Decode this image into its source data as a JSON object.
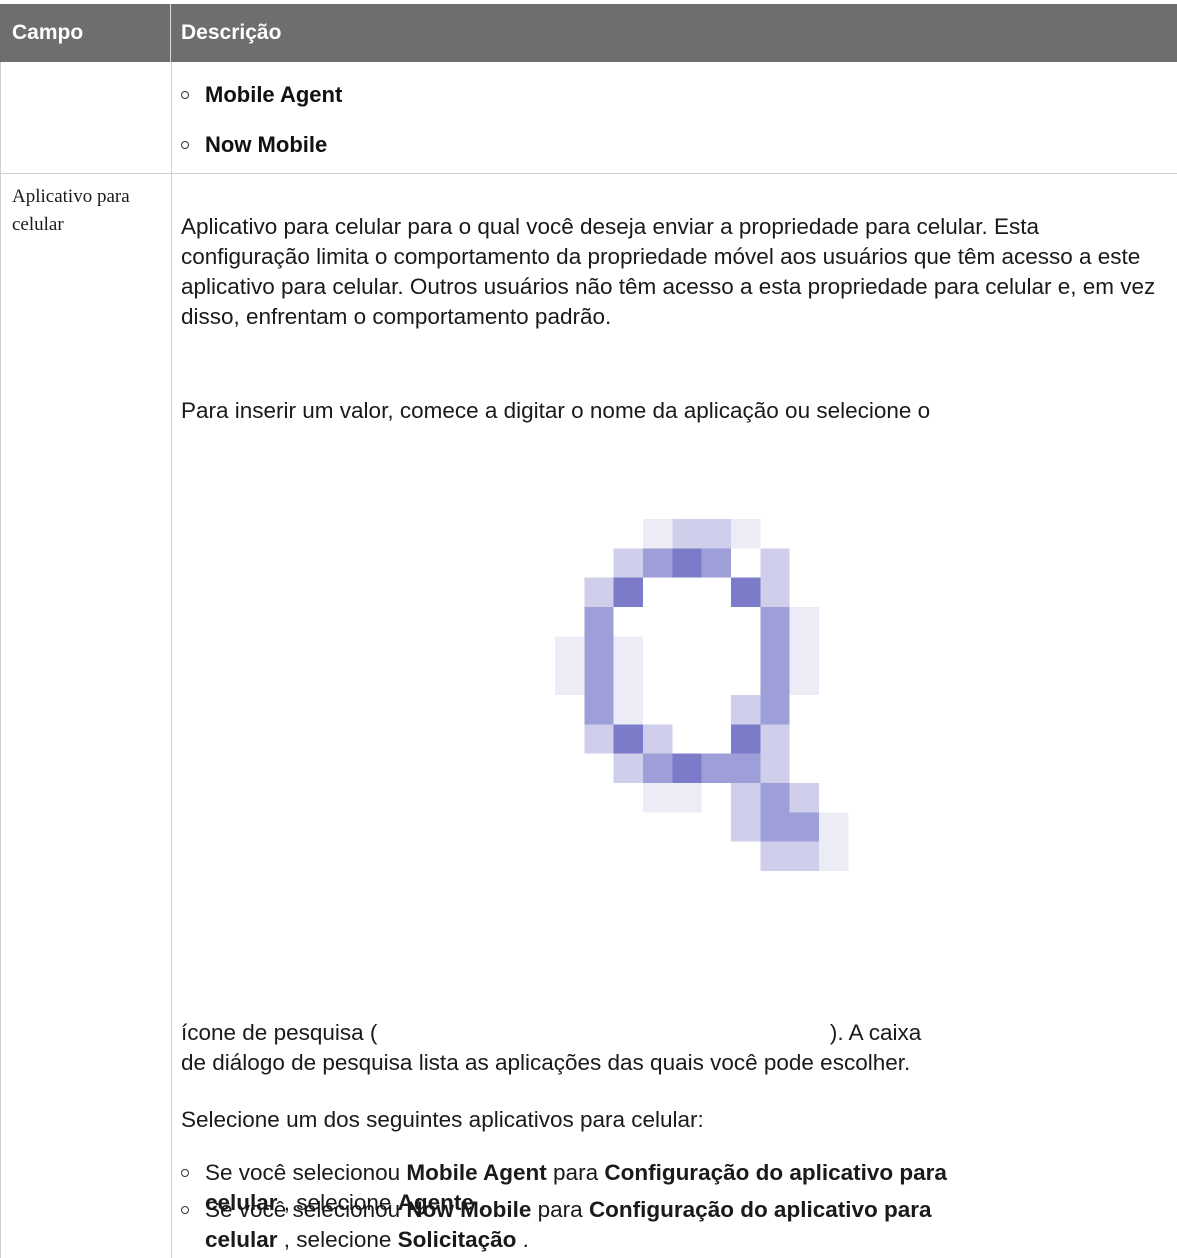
{
  "table": {
    "headers": [
      "Campo",
      "Descrição"
    ]
  },
  "row1": {
    "items": [
      "Mobile Agent",
      "Now Mobile"
    ]
  },
  "row2": {
    "field_label": "Aplicativo para celular",
    "paragraph1": "Aplicativo para celular para o qual você deseja enviar a propriedade para celular. Esta configuração limita o comportamento da propriedade móvel aos usuários que têm acesso a este aplicativo para celular. Outros usuários não têm acesso a esta propriedade para celular e, em vez disso, enfrentam o comportamento padrão.",
    "paragraph2_start": "Para inserir um valor, comece a digitar o nome da aplicação ou selecione o",
    "paragraph2_icon": "search-icon",
    "paragraph2_line_a_left": "ícone de pesquisa (",
    "paragraph2_line_a_right": "). A caixa",
    "paragraph2_line_b": "de diálogo de pesquisa lista as aplicações das quais você pode escolher.",
    "paragraph3": "Selecione um dos seguintes aplicativos para celular:",
    "options": [
      {
        "prefix": "Se você selecionou ",
        "app": "Mobile Agent",
        "mid": " para ",
        "config_a": "Configuração do aplicativo para",
        "config_b": "celular",
        "suffix_a": " , selecione ",
        "choice": "Agente",
        "end": " ."
      },
      {
        "prefix": "Se você selecionou ",
        "app": "Now Mobile",
        "mid": " para ",
        "config_a": "Configuração do aplicativo para",
        "config_b": "celular",
        "suffix_a": " , selecione ",
        "choice": "Solicitação",
        "end": " ."
      }
    ]
  },
  "colors": {
    "header_bg": "#6e6e6e",
    "header_text": "#ffffff",
    "icon_accent": "#8a8ad2"
  }
}
